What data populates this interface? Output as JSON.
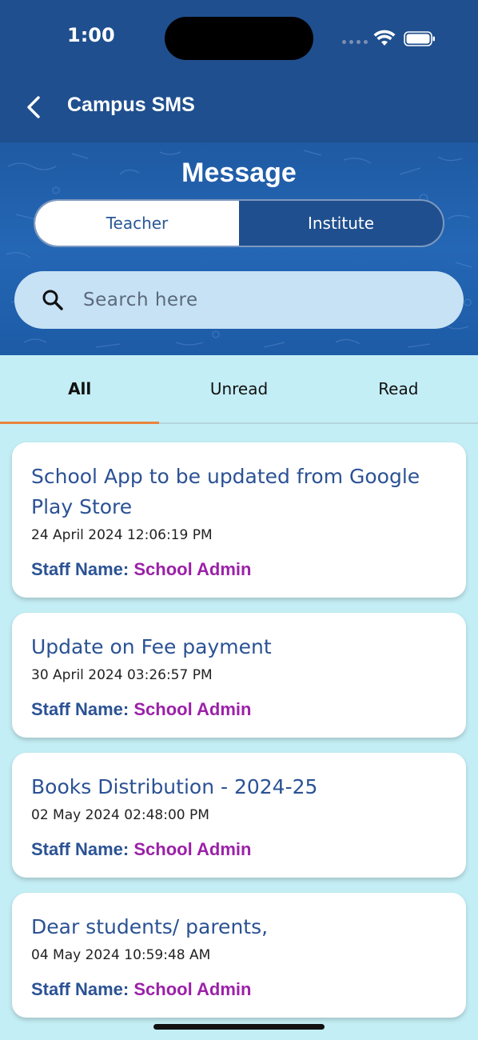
{
  "status": {
    "time": "1:00"
  },
  "app_bar": {
    "title": "Campus SMS"
  },
  "page": {
    "title": "Message"
  },
  "segment": {
    "options": [
      "Teacher",
      "Institute"
    ],
    "selected": "Teacher"
  },
  "search": {
    "placeholder": "Search here"
  },
  "tabs": {
    "items": [
      "All",
      "Unread",
      "Read"
    ],
    "active": "All"
  },
  "messages": [
    {
      "title": "School App to be updated from Google Play Store",
      "date": "24 April 2024 12:06:19 PM",
      "staff_label": "Staff Name:",
      "staff": "School Admin"
    },
    {
      "title": "Update on Fee payment",
      "date": "30 April 2024 03:26:57 PM",
      "staff_label": "Staff Name:",
      "staff": "School Admin"
    },
    {
      "title": "Books Distribution - 2024-25",
      "date": "02 May 2024 02:48:00 PM",
      "staff_label": "Staff Name:",
      "staff": "School Admin"
    },
    {
      "title": "Dear students/ parents,",
      "date": "04 May 2024 10:59:48 AM",
      "staff_label": "Staff Name:",
      "staff": "School Admin"
    }
  ],
  "colors": {
    "primary": "#1f4f8e",
    "accent_tab": "#e8843b",
    "staff_value": "#9b21a8",
    "list_bg": "#c4eef5"
  }
}
